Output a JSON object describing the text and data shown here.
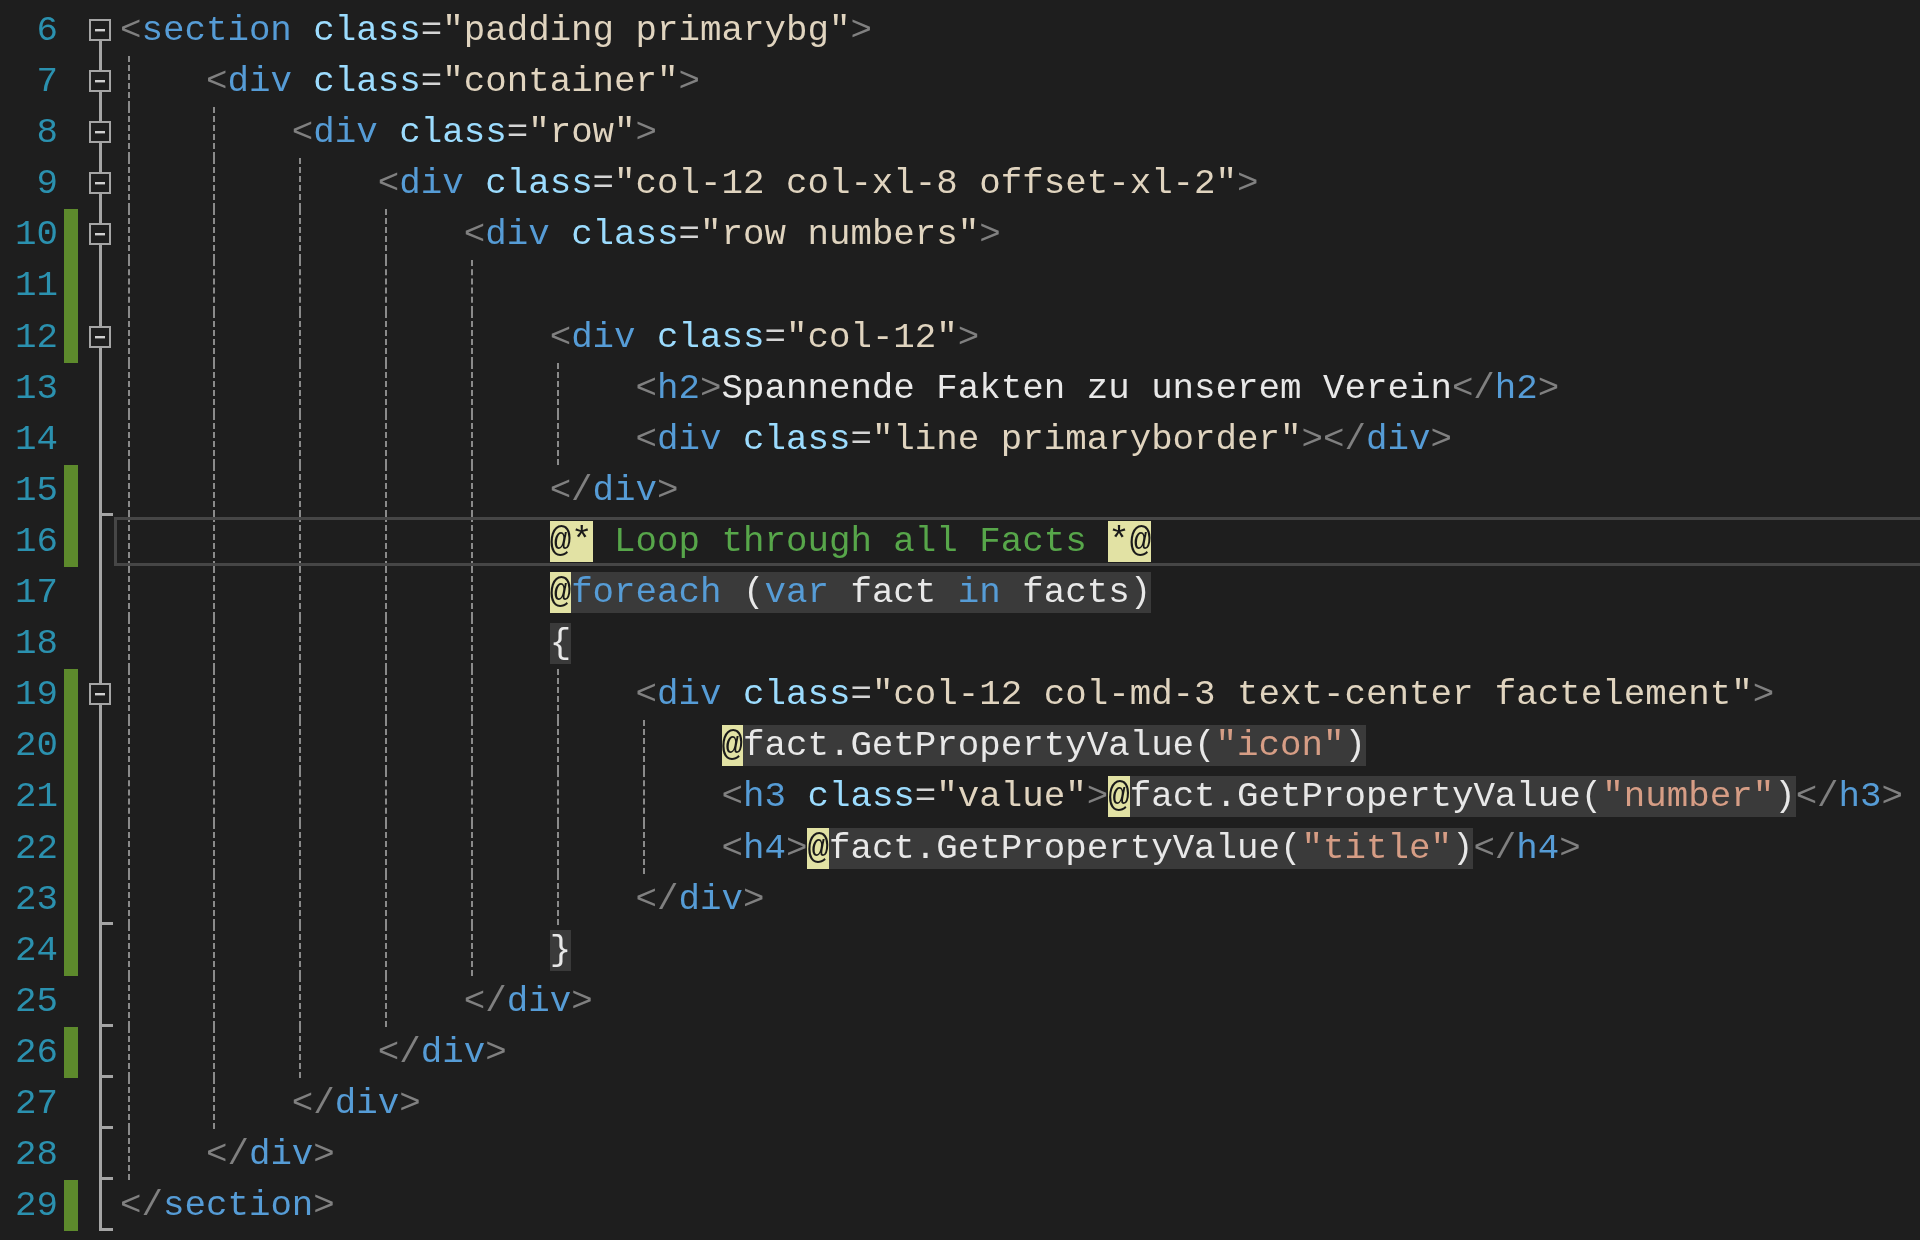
{
  "editor": {
    "lines": [
      {
        "number": "6",
        "changed": false,
        "current": false,
        "foldable": true,
        "block_end": false,
        "tokens": [
          {
            "kind": "punct",
            "text": "<"
          },
          {
            "kind": "tag",
            "text": "section"
          },
          {
            "kind": "attr",
            "text": " class"
          },
          {
            "kind": "eq",
            "text": "="
          },
          {
            "kind": "value",
            "text": "\"padding primarybg\""
          },
          {
            "kind": "punct",
            "text": ">"
          }
        ]
      },
      {
        "number": "7",
        "changed": false,
        "current": false,
        "foldable": true,
        "block_end": false,
        "tokens": [
          {
            "kind": "punct",
            "text": "    <"
          },
          {
            "kind": "tag",
            "text": "div"
          },
          {
            "kind": "attr",
            "text": " class"
          },
          {
            "kind": "eq",
            "text": "="
          },
          {
            "kind": "value",
            "text": "\"container\""
          },
          {
            "kind": "punct",
            "text": ">"
          }
        ]
      },
      {
        "number": "8",
        "changed": false,
        "current": false,
        "foldable": true,
        "block_end": false,
        "tokens": [
          {
            "kind": "punct",
            "text": "        <"
          },
          {
            "kind": "tag",
            "text": "div"
          },
          {
            "kind": "attr",
            "text": " class"
          },
          {
            "kind": "eq",
            "text": "="
          },
          {
            "kind": "value",
            "text": "\"row\""
          },
          {
            "kind": "punct",
            "text": ">"
          }
        ]
      },
      {
        "number": "9",
        "changed": false,
        "current": false,
        "foldable": true,
        "block_end": false,
        "tokens": [
          {
            "kind": "punct",
            "text": "            <"
          },
          {
            "kind": "tag",
            "text": "div"
          },
          {
            "kind": "attr",
            "text": " class"
          },
          {
            "kind": "eq",
            "text": "="
          },
          {
            "kind": "value",
            "text": "\"col-12 col-xl-8 offset-xl-2\""
          },
          {
            "kind": "punct",
            "text": ">"
          }
        ]
      },
      {
        "number": "10",
        "changed": true,
        "current": false,
        "foldable": true,
        "block_end": false,
        "tokens": [
          {
            "kind": "punct",
            "text": "                <"
          },
          {
            "kind": "tag",
            "text": "div"
          },
          {
            "kind": "attr",
            "text": " class"
          },
          {
            "kind": "eq",
            "text": "="
          },
          {
            "kind": "value",
            "text": "\"row numbers\""
          },
          {
            "kind": "punct",
            "text": ">"
          }
        ]
      },
      {
        "number": "11",
        "changed": true,
        "current": false,
        "foldable": false,
        "block_end": false
      },
      {
        "number": "12",
        "changed": true,
        "current": false,
        "foldable": true,
        "block_end": false,
        "tokens": [
          {
            "kind": "punct",
            "text": "                    <"
          },
          {
            "kind": "tag",
            "text": "div"
          },
          {
            "kind": "attr",
            "text": " class"
          },
          {
            "kind": "eq",
            "text": "="
          },
          {
            "kind": "value",
            "text": "\"col-12\""
          },
          {
            "kind": "punct",
            "text": ">"
          }
        ]
      },
      {
        "number": "13",
        "changed": false,
        "current": false,
        "foldable": false,
        "block_end": false,
        "tokens": [
          {
            "kind": "punct",
            "text": "                        <"
          },
          {
            "kind": "tag",
            "text": "h2"
          },
          {
            "kind": "punct",
            "text": ">"
          },
          {
            "kind": "text",
            "text": "Spannende Fakten zu unserem Verein"
          },
          {
            "kind": "punct",
            "text": "</"
          },
          {
            "kind": "tag",
            "text": "h2"
          },
          {
            "kind": "punct",
            "text": ">"
          }
        ]
      },
      {
        "number": "14",
        "changed": false,
        "current": false,
        "foldable": false,
        "block_end": false,
        "tokens": [
          {
            "kind": "punct",
            "text": "                        <"
          },
          {
            "kind": "tag",
            "text": "div"
          },
          {
            "kind": "attr",
            "text": " class"
          },
          {
            "kind": "eq",
            "text": "="
          },
          {
            "kind": "value",
            "text": "\"line primaryborder\""
          },
          {
            "kind": "punct",
            "text": "></"
          },
          {
            "kind": "tag",
            "text": "div"
          },
          {
            "kind": "punct",
            "text": ">"
          }
        ]
      },
      {
        "number": "15",
        "changed": true,
        "current": false,
        "foldable": false,
        "block_end": true,
        "tokens": [
          {
            "kind": "punct",
            "text": "                    </"
          },
          {
            "kind": "tag",
            "text": "div"
          },
          {
            "kind": "punct",
            "text": ">"
          }
        ]
      },
      {
        "number": "16",
        "changed": true,
        "current": true,
        "foldable": false,
        "block_end": false,
        "tokens": [
          {
            "kind": "at",
            "text": "                    @*"
          },
          {
            "kind": "comment",
            "text": " Loop through all Facts "
          },
          {
            "kind": "at",
            "text": "*@"
          }
        ]
      },
      {
        "number": "17",
        "changed": false,
        "current": false,
        "foldable": false,
        "block_end": false,
        "tokens": [
          {
            "kind": "at",
            "text": "                    @"
          },
          {
            "kind": "keyword",
            "text": "foreach",
            "block": true
          },
          {
            "kind": "code",
            "text": " (",
            "block": true
          },
          {
            "kind": "keyword",
            "text": "var",
            "block": true
          },
          {
            "kind": "code",
            "text": " fact ",
            "block": true
          },
          {
            "kind": "keyword",
            "text": "in",
            "block": true
          },
          {
            "kind": "code",
            "text": " facts)",
            "block": true
          }
        ]
      },
      {
        "number": "18",
        "changed": false,
        "current": false,
        "foldable": false,
        "block_end": false,
        "tokens": [
          {
            "kind": "code",
            "text": "                    {",
            "block": true
          }
        ]
      },
      {
        "number": "19",
        "changed": true,
        "current": false,
        "foldable": true,
        "block_end": false,
        "tokens": [
          {
            "kind": "punct",
            "text": "                        <"
          },
          {
            "kind": "tag",
            "text": "div"
          },
          {
            "kind": "attr",
            "text": " class"
          },
          {
            "kind": "eq",
            "text": "="
          },
          {
            "kind": "value",
            "text": "\"col-12 col-md-3 text-center factelement\""
          },
          {
            "kind": "punct",
            "text": ">"
          }
        ]
      },
      {
        "number": "20",
        "changed": true,
        "current": false,
        "foldable": false,
        "block_end": false,
        "tokens": [
          {
            "kind": "at",
            "text": "                            @"
          },
          {
            "kind": "code",
            "text": "fact.GetPropertyValue(",
            "block": true
          },
          {
            "kind": "string",
            "text": "\"icon\"",
            "block": true
          },
          {
            "kind": "code",
            "text": ")",
            "block": true
          }
        ]
      },
      {
        "number": "21",
        "changed": true,
        "current": false,
        "foldable": false,
        "block_end": false,
        "tokens": [
          {
            "kind": "punct",
            "text": "                            <"
          },
          {
            "kind": "tag",
            "text": "h3"
          },
          {
            "kind": "attr",
            "text": " class"
          },
          {
            "kind": "eq",
            "text": "="
          },
          {
            "kind": "value",
            "text": "\"value\""
          },
          {
            "kind": "punct",
            "text": ">"
          },
          {
            "kind": "at",
            "text": "@"
          },
          {
            "kind": "code",
            "text": "fact.GetPropertyValue(",
            "block": true
          },
          {
            "kind": "string",
            "text": "\"number\"",
            "block": true
          },
          {
            "kind": "code",
            "text": ")",
            "block": true
          },
          {
            "kind": "punct",
            "text": "</"
          },
          {
            "kind": "tag",
            "text": "h3"
          },
          {
            "kind": "punct",
            "text": ">"
          }
        ]
      },
      {
        "number": "22",
        "changed": true,
        "current": false,
        "foldable": false,
        "block_end": false,
        "tokens": [
          {
            "kind": "punct",
            "text": "                            <"
          },
          {
            "kind": "tag",
            "text": "h4"
          },
          {
            "kind": "punct",
            "text": ">"
          },
          {
            "kind": "at",
            "text": "@"
          },
          {
            "kind": "code",
            "text": "fact.GetPropertyValue(",
            "block": true
          },
          {
            "kind": "string",
            "text": "\"title\"",
            "block": true
          },
          {
            "kind": "code",
            "text": ")",
            "block": true
          },
          {
            "kind": "punct",
            "text": "</"
          },
          {
            "kind": "tag",
            "text": "h4"
          },
          {
            "kind": "punct",
            "text": ">"
          }
        ]
      },
      {
        "number": "23",
        "changed": true,
        "current": false,
        "foldable": false,
        "block_end": true,
        "tokens": [
          {
            "kind": "punct",
            "text": "                        </"
          },
          {
            "kind": "tag",
            "text": "div"
          },
          {
            "kind": "punct",
            "text": ">"
          }
        ]
      },
      {
        "number": "24",
        "changed": true,
        "current": false,
        "foldable": false,
        "block_end": false,
        "tokens": [
          {
            "kind": "code",
            "text": "                    }",
            "block": true
          }
        ]
      },
      {
        "number": "25",
        "changed": false,
        "current": false,
        "foldable": false,
        "block_end": true,
        "tokens": [
          {
            "kind": "punct",
            "text": "                </"
          },
          {
            "kind": "tag",
            "text": "div"
          },
          {
            "kind": "punct",
            "text": ">"
          }
        ]
      },
      {
        "number": "26",
        "changed": true,
        "current": false,
        "foldable": false,
        "block_end": true,
        "tokens": [
          {
            "kind": "punct",
            "text": "            </"
          },
          {
            "kind": "tag",
            "text": "div"
          },
          {
            "kind": "punct",
            "text": ">"
          }
        ]
      },
      {
        "number": "27",
        "changed": false,
        "current": false,
        "foldable": false,
        "block_end": true,
        "tokens": [
          {
            "kind": "punct",
            "text": "        </"
          },
          {
            "kind": "tag",
            "text": "div"
          },
          {
            "kind": "punct",
            "text": ">"
          }
        ]
      },
      {
        "number": "28",
        "changed": false,
        "current": false,
        "foldable": false,
        "block_end": true,
        "tokens": [
          {
            "kind": "punct",
            "text": "    </"
          },
          {
            "kind": "tag",
            "text": "div"
          },
          {
            "kind": "punct",
            "text": ">"
          }
        ]
      },
      {
        "number": "29",
        "changed": true,
        "current": false,
        "foldable": false,
        "block_end": true,
        "tokens": [
          {
            "kind": "punct",
            "text": "</"
          },
          {
            "kind": "tag",
            "text": "section"
          },
          {
            "kind": "punct",
            "text": ">"
          }
        ]
      }
    ]
  }
}
